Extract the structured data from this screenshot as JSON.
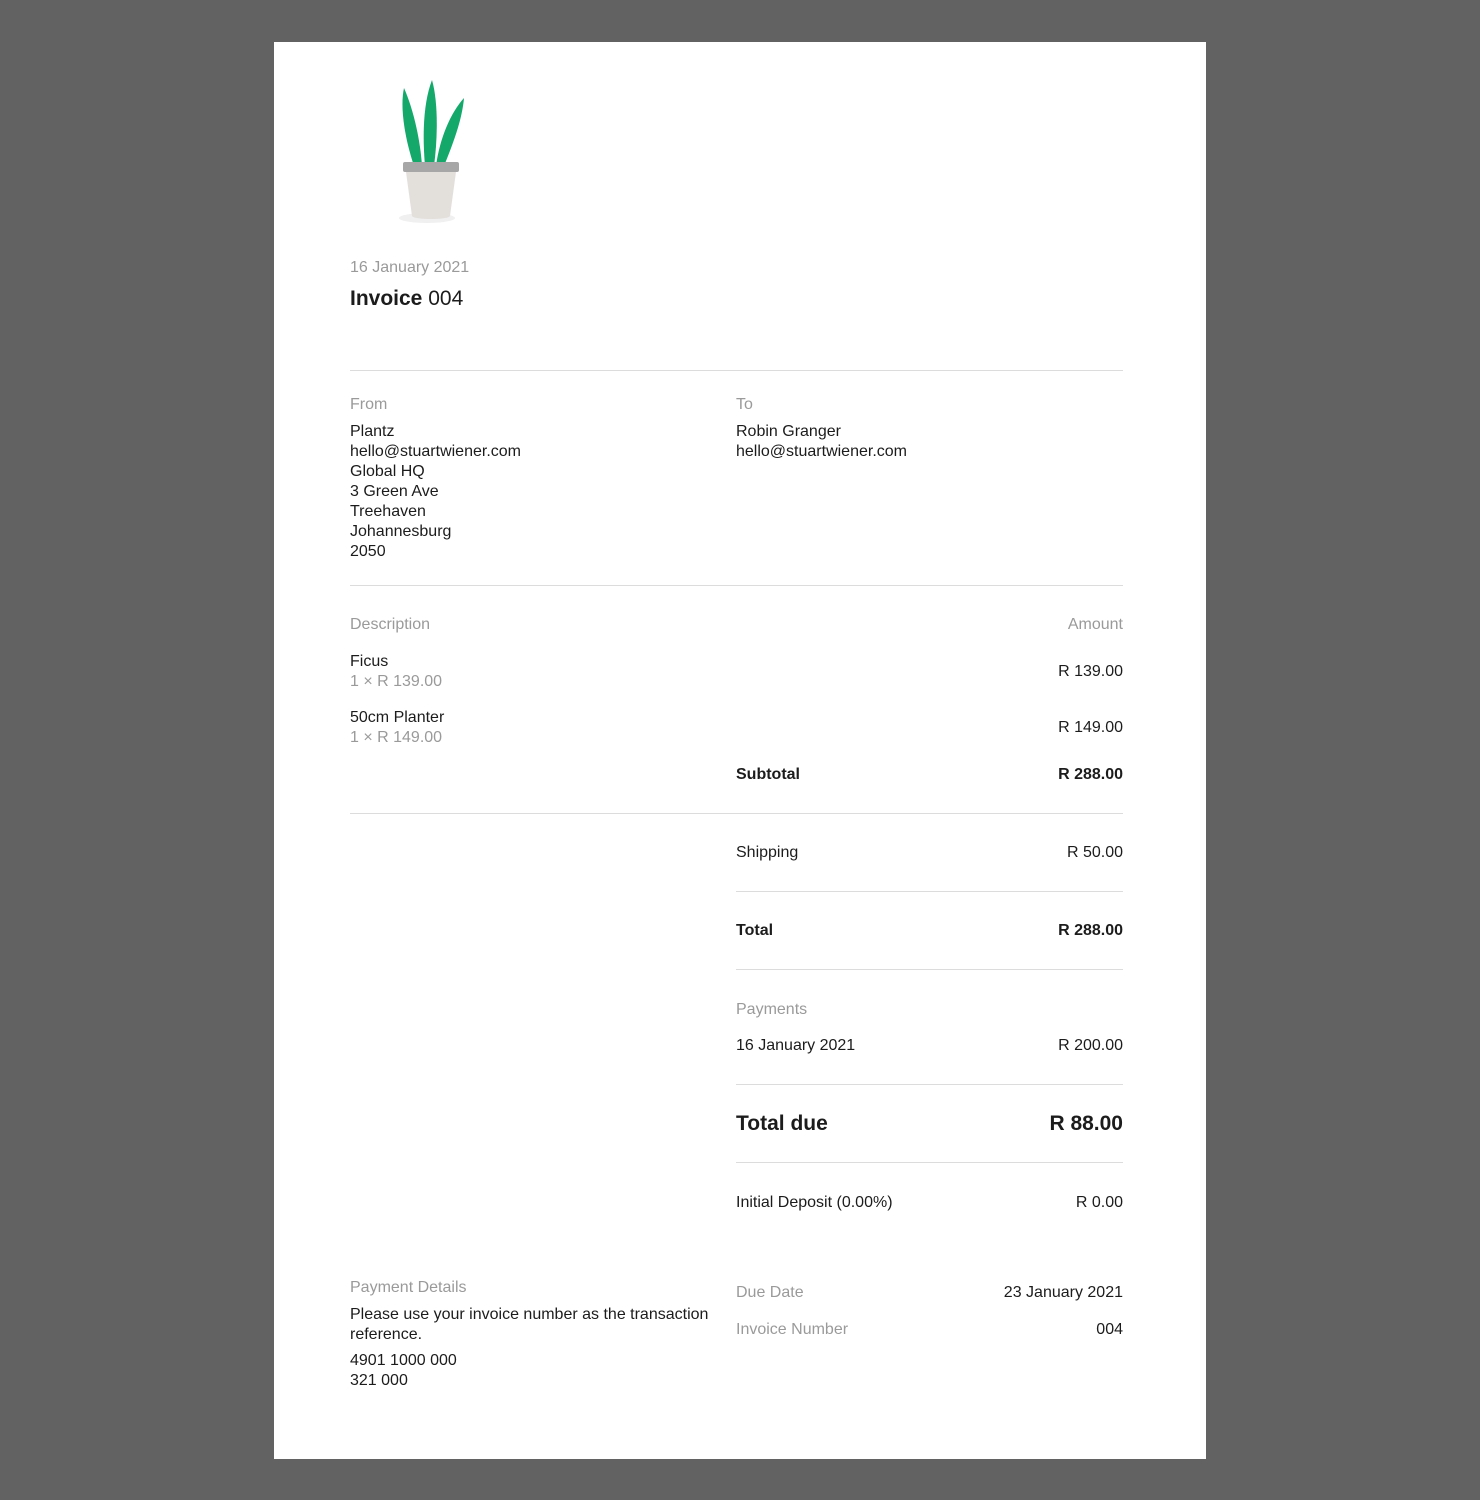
{
  "invoice": {
    "date": "16 January 2021",
    "title_keyword": "Invoice",
    "number": "004"
  },
  "logo": {
    "name": "potted-plant-icon",
    "leaf_color": "#14a86b",
    "pot_color": "#e3e0dc",
    "rim_color": "#a7a7a7"
  },
  "from": {
    "label": "From",
    "lines": [
      "Plantz",
      "hello@stuartwiener.com",
      "Global HQ",
      "3 Green Ave",
      "Treehaven",
      "Johannesburg",
      "2050"
    ]
  },
  "to": {
    "label": "To",
    "lines": [
      "Robin Granger",
      "hello@stuartwiener.com"
    ]
  },
  "items_header": {
    "description": "Description",
    "amount": "Amount"
  },
  "items": [
    {
      "name": "Ficus",
      "detail": "1 × R 139.00",
      "amount": "R 139.00"
    },
    {
      "name": "50cm Planter",
      "detail": "1 × R 149.00",
      "amount": "R 149.00"
    }
  ],
  "summary": {
    "subtotal_label": "Subtotal",
    "subtotal_value": "R 288.00",
    "shipping_label": "Shipping",
    "shipping_value": "R 50.00",
    "total_label": "Total",
    "total_value": "R 288.00",
    "payments_label": "Payments",
    "payments": [
      {
        "date": "16 January 2021",
        "amount": "R 200.00"
      }
    ],
    "total_due_label": "Total due",
    "total_due_value": "R 88.00",
    "deposit_label": "Initial Deposit (0.00%)",
    "deposit_value": "R 0.00"
  },
  "payment_details": {
    "label": "Payment Details",
    "text": "Please use your invoice number as the transaction reference.",
    "account_lines": [
      "4901 1000 000",
      "321 000"
    ]
  },
  "meta": {
    "due_date_label": "Due Date",
    "due_date_value": "23 January 2021",
    "invoice_number_label": "Invoice Number",
    "invoice_number_value": "004"
  }
}
